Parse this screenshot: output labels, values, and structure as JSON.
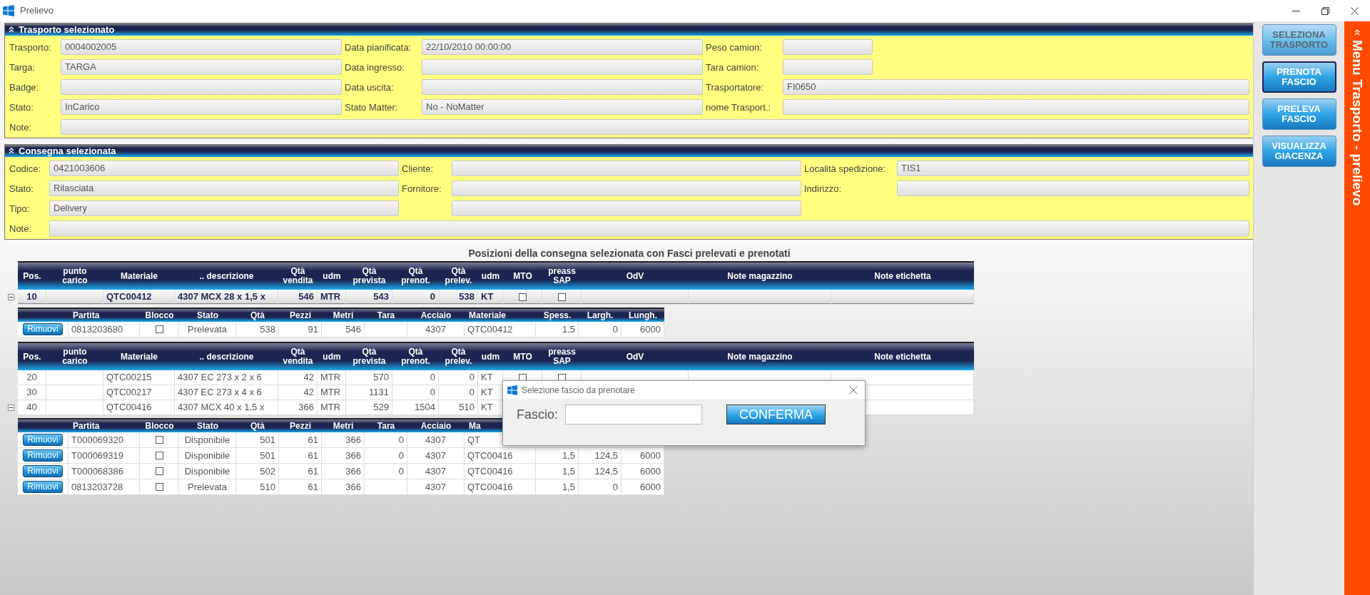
{
  "window": {
    "title": "Prelievo"
  },
  "trasporto": {
    "title": "Trasporto selezionato",
    "expanded": true,
    "rows": [
      [
        {
          "kind": "field",
          "label": "Trasporto:",
          "value": "0004002005"
        },
        {
          "kind": "field",
          "label": "Data pianificata:",
          "value": "22/10/2010 00:00:00"
        },
        {
          "kind": "field",
          "label": "Peso camion:"
        }
      ],
      [
        {
          "kind": "field",
          "label": "Targa:",
          "value": "TARGA"
        },
        {
          "kind": "field",
          "label": "Data ingresso:"
        },
        {
          "kind": "field",
          "label": "Tara camion:"
        }
      ],
      [
        {
          "kind": "field",
          "label": "Badge:"
        },
        {
          "kind": "field",
          "label": "Data uscita:"
        },
        {
          "kind": "field",
          "label": "Trasportatore:",
          "value": "FI0650"
        }
      ],
      [
        {
          "kind": "field",
          "label": "Stato:",
          "value": "InCarico"
        },
        {
          "kind": "field",
          "label": "Stato Matter:",
          "value": "No - NoMatter"
        },
        {
          "kind": "field",
          "label": "nome Trasport.:"
        }
      ],
      [
        {
          "kind": "field",
          "label": "Note:"
        }
      ]
    ]
  },
  "consegna": {
    "title": "Consegna selezionata",
    "expanded": true,
    "rows": [
      [
        {
          "kind": "field",
          "label": "Codice:",
          "value": "0421003606"
        },
        {
          "kind": "field",
          "label": "Cliente:"
        },
        {
          "kind": "field",
          "label": "Località spedizione:",
          "value": "TIS1"
        }
      ],
      [
        {
          "kind": "field",
          "label": "Stato:",
          "value": "Rilasciata"
        },
        {
          "kind": "field",
          "label": "Fornitore:"
        },
        {
          "kind": "field",
          "label": "Indirizzo:"
        }
      ],
      [
        {
          "kind": "field",
          "label": "Tipo:",
          "value": "Delivery"
        },
        {
          "kind": "field"
        }
      ],
      [
        {
          "kind": "field",
          "label": "Note:"
        }
      ]
    ]
  },
  "grid": {
    "title": "Posizioni della consegna selezionata con Fasci prelevati e prenotati",
    "bands": [
      {
        "columns": [
          {
            "label": "Pos.",
            "kind": "center"
          },
          {
            "label": "punto\ncarico",
            "kind": "text"
          },
          {
            "label": "Materiale",
            "kind": "text"
          },
          {
            "label": ".. descrizione",
            "kind": "text"
          },
          {
            "label": "Qtà\nvendita",
            "kind": "num"
          },
          {
            "label": "udm",
            "kind": "text"
          },
          {
            "label": "Qtà\nprevista",
            "kind": "num"
          },
          {
            "label": "Qtà\nprenot.",
            "kind": "num"
          },
          {
            "label": "Qtà\nprelev.",
            "kind": "num"
          },
          {
            "label": "udm",
            "kind": "text"
          },
          {
            "label": "MTO",
            "kind": "check"
          },
          {
            "label": "preass\nSAP",
            "kind": "check"
          },
          {
            "label": "OdV",
            "kind": "text"
          },
          {
            "label": "Note magazzino",
            "kind": "text"
          },
          {
            "label": "Note etichetta",
            "kind": "text"
          }
        ],
        "rows": [
          {
            "selected": true,
            "expanded": true,
            "cells": [
              "10",
              null,
              "QTC00412",
              "4307 MCX 28 x 1,5 x",
              "546",
              "MTR",
              "543",
              "0",
              "538",
              "KT",
              {
                "checked": false
              },
              {
                "checked": false
              },
              null,
              null,
              null
            ],
            "detail": {
              "columns": [
                {
                  "kind": "button"
                },
                {
                  "label": "Partita",
                  "kind": "text"
                },
                {
                  "label": "Blocco",
                  "kind": "check"
                },
                {
                  "label": "Stato",
                  "kind": "center"
                },
                {
                  "label": "Qtà",
                  "kind": "num"
                },
                {
                  "label": "Pezzi",
                  "kind": "num"
                },
                {
                  "label": "Metri",
                  "kind": "num"
                },
                {
                  "label": "Tara",
                  "kind": "num"
                },
                {
                  "label": "Acciaio",
                  "kind": "center"
                },
                {
                  "label": "Materiale",
                  "kind": "text"
                },
                {
                  "label": "Spess.",
                  "kind": "num"
                },
                {
                  "label": "Largh.",
                  "kind": "num"
                },
                {
                  "label": "Lungh.",
                  "kind": "num"
                }
              ],
              "rows": [
                {
                  "cells": [
                    {
                      "button": "Rimuovi"
                    },
                    "0813203680",
                    {
                      "checked": false
                    },
                    "Prelevata",
                    "538",
                    "91",
                    "546",
                    null,
                    "4307",
                    "QTC00412",
                    "1,5",
                    "0",
                    "6000"
                  ]
                }
              ]
            }
          }
        ]
      },
      {
        "columns": [
          {
            "label": "Pos.",
            "kind": "center"
          },
          {
            "label": "punto\ncarico",
            "kind": "text"
          },
          {
            "label": "Materiale",
            "kind": "text"
          },
          {
            "label": ".. descrizione",
            "kind": "text"
          },
          {
            "label": "Qtà\nvendita",
            "kind": "num"
          },
          {
            "label": "udm",
            "kind": "text"
          },
          {
            "label": "Qtà\nprevista",
            "kind": "num"
          },
          {
            "label": "Qtà\nprenot.",
            "kind": "num"
          },
          {
            "label": "Qtà\nprelev.",
            "kind": "num"
          },
          {
            "label": "udm",
            "kind": "text"
          },
          {
            "label": "MTO",
            "kind": "check"
          },
          {
            "label": "preass\nSAP",
            "kind": "check"
          },
          {
            "label": "OdV",
            "kind": "text"
          },
          {
            "label": "Note magazzino",
            "kind": "text"
          },
          {
            "label": "Note etichetta",
            "kind": "text"
          }
        ],
        "rows": [
          {
            "selected": false,
            "expanded": false,
            "cells": [
              "20",
              null,
              "QTC00215",
              "4307 EC 273 x 2 x 6",
              "42",
              "MTR",
              "570",
              "0",
              "0",
              "KT",
              {
                "checked": false
              },
              {
                "checked": false
              },
              null,
              null,
              null
            ]
          },
          {
            "selected": false,
            "expanded": false,
            "cells": [
              "30",
              null,
              "QTC00217",
              "4307 EC 273 x 4 x 6",
              "42",
              "MTR",
              "1131",
              "0",
              "0",
              "KT",
              null,
              null,
              null,
              null,
              null
            ]
          },
          {
            "selected": false,
            "expanded": true,
            "cells": [
              "40",
              null,
              "QTC00416",
              "4307 MCX 40 x 1,5 x",
              "366",
              "MTR",
              "529",
              "1504",
              "510",
              "KT",
              null,
              null,
              null,
              null,
              null
            ],
            "detail": {
              "columns": [
                {
                  "kind": "button"
                },
                {
                  "label": "Partita",
                  "kind": "text"
                },
                {
                  "label": "Blocco",
                  "kind": "check"
                },
                {
                  "label": "Stato",
                  "kind": "center"
                },
                {
                  "label": "Qtà",
                  "kind": "num"
                },
                {
                  "label": "Pezzi",
                  "kind": "num"
                },
                {
                  "label": "Metri",
                  "kind": "num"
                },
                {
                  "label": "Tara",
                  "kind": "num"
                },
                {
                  "label": "Acciaio",
                  "kind": "center"
                },
                {
                  "label": "Ma",
                  "kind": "text"
                },
                {
                  "kind": "num"
                },
                {
                  "kind": "num"
                },
                {
                  "kind": "num"
                }
              ],
              "rows": [
                {
                  "cells": [
                    {
                      "button": "Rimuovi"
                    },
                    "T000069320",
                    {
                      "checked": false
                    },
                    "Disponibile",
                    "501",
                    "61",
                    "366",
                    "0",
                    "4307",
                    "QT",
                    null,
                    null,
                    null
                  ]
                },
                {
                  "cells": [
                    {
                      "button": "Rimuovi"
                    },
                    "T000069319",
                    {
                      "checked": false
                    },
                    "Disponibile",
                    "501",
                    "61",
                    "366",
                    "0",
                    "4307",
                    "QTC00416",
                    "1,5",
                    "124,5",
                    "6000"
                  ]
                },
                {
                  "cells": [
                    {
                      "button": "Rimuovi"
                    },
                    "T000068386",
                    {
                      "checked": false
                    },
                    "Disponibile",
                    "502",
                    "61",
                    "366",
                    "0",
                    "4307",
                    "QTC00416",
                    "1,5",
                    "124,5",
                    "6000"
                  ]
                },
                {
                  "cells": [
                    {
                      "button": "Rimuovi"
                    },
                    "0813203728",
                    {
                      "checked": false
                    },
                    "Prelevata",
                    "510",
                    "61",
                    "366",
                    null,
                    "4307",
                    "QTC00416",
                    "1,5",
                    "0",
                    "6000"
                  ]
                }
              ]
            }
          }
        ]
      }
    ]
  },
  "actions": [
    {
      "label": "SELEZIONA TRASPORTO",
      "disabled": true,
      "focused": false
    },
    {
      "label": "PRENOTA FASCIO",
      "disabled": false,
      "focused": true
    },
    {
      "label": "PRELEVA FASCIO",
      "disabled": false,
      "focused": false
    },
    {
      "label": "VISUALIZZA GIACENZA",
      "disabled": false,
      "focused": false
    }
  ],
  "side_menu": {
    "title": "Menu Trasporto - prelievo"
  },
  "dialog": {
    "title": "Selezione fascio da prenotare",
    "field_label": "Fascio:",
    "button": "CONFERMA"
  }
}
